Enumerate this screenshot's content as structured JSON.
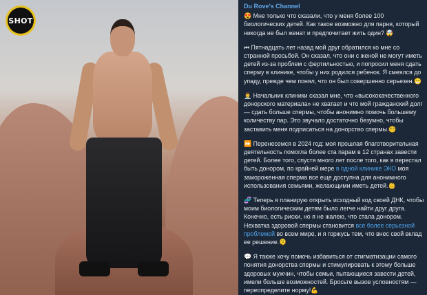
{
  "photo": {
    "logo_text": "SHOT"
  },
  "post": {
    "channel_name": "Du Rove's Channel",
    "paragraphs": [
      {
        "icon": "😍",
        "parts": [
          {
            "text": " Мне только что сказали, что у меня более 100 биологических детей. Как такое возможно для парня, который никогда не был женат и предпочитает жить один? "
          },
          {
            "text": "🤯"
          }
        ]
      },
      {
        "icon": "⏮",
        "parts": [
          {
            "text": " Пятнадцать лет назад мой друг обратился ко мне со странной просьбой. Он сказал, что они с женой не могут иметь детей из-за проблем с фертильностью, и попросил меня сдать сперму в клинике, чтобы у них родился ребенок. Я смеялся до упаду, прежде чем понял, что он был совершенно серьезен."
          },
          {
            "text": "😁"
          }
        ]
      },
      {
        "icon": "👨‍⚕️",
        "parts": [
          {
            "text": " Начальник клиники сказал мне, что «высококачественного донорского материала» не хватает и что мой гражданский долг — сдать больше спермы, чтобы анонимно помочь большему количеству пар. Это звучало достаточно безумно, чтобы заставить меня подписаться на донорство спермы."
          },
          {
            "text": "😵‍💫"
          }
        ]
      },
      {
        "icon": "⏩",
        "parts": [
          {
            "text": " Перенесемся в 2024 год: моя прошлая благотворительная деятельность помогла более ста парам в 12 странах завести детей. Более того, спустя много лет после того, как я перестал быть донором, по крайней мере "
          },
          {
            "text": "в одной клинике ЭКО",
            "link": true
          },
          {
            "text": " моя замороженная сперма все еще доступна для анонимного использования семьями, желающими иметь детей."
          },
          {
            "text": "👶"
          }
        ]
      },
      {
        "icon": "🧬",
        "parts": [
          {
            "text": " Теперь я планирую открыть исходный код своей ДНК, чтобы моим биологическим детям было легче найти друг друга. Конечно, есть риски, но я не жалею, что стала донором. Нехватка здоровой спермы становится "
          },
          {
            "text": "все более серьезной проблемой",
            "link": true
          },
          {
            "text": " во всем мире, и я горжусь тем, что внес свой вклад ее решение."
          },
          {
            "text": "🫠"
          }
        ]
      },
      {
        "icon": "💬",
        "parts": [
          {
            "text": " Я также хочу помочь избавиться от стигматизации самого понятия донорства спермы и стимулировать к этому больше здоровых мужчин, чтобы семьи, пытающиеся завести детей, имели больше возможностей. Бросьте вызов условностям — переопределите норму!"
          },
          {
            "text": "💪"
          }
        ]
      }
    ]
  }
}
